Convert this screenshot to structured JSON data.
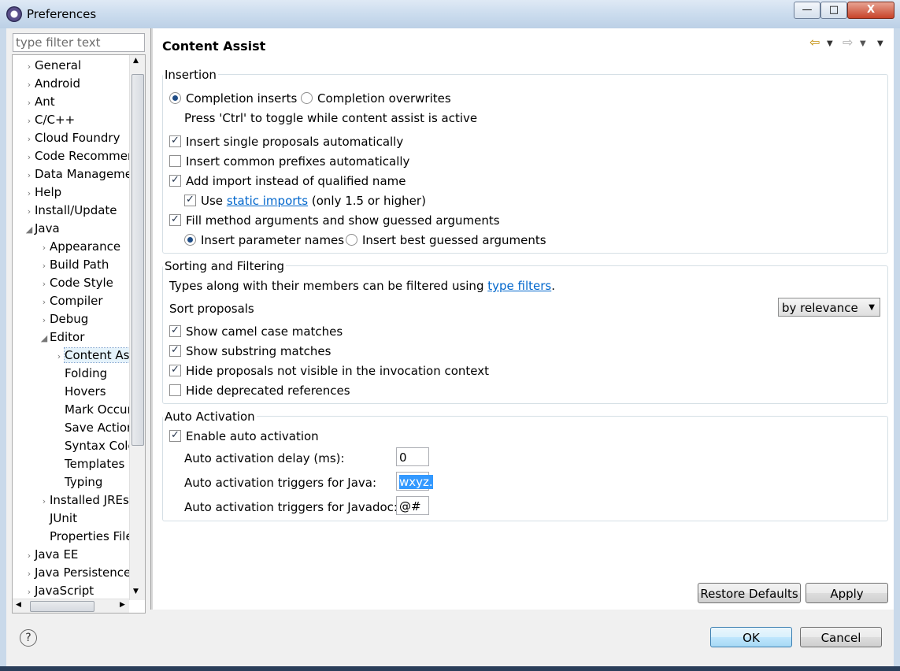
{
  "window": {
    "title": "Preferences",
    "buttons": {
      "minimize": "—",
      "maximize": "□",
      "close": "X"
    }
  },
  "filter": {
    "placeholder": "type filter text"
  },
  "tree": [
    {
      "label": "General",
      "level": 0,
      "twisty": "›"
    },
    {
      "label": "Android",
      "level": 0,
      "twisty": "›"
    },
    {
      "label": "Ant",
      "level": 0,
      "twisty": "›"
    },
    {
      "label": "C/C++",
      "level": 0,
      "twisty": "›"
    },
    {
      "label": "Cloud Foundry",
      "level": 0,
      "twisty": "›"
    },
    {
      "label": "Code Recommenders",
      "level": 0,
      "twisty": "›"
    },
    {
      "label": "Data Management",
      "level": 0,
      "twisty": "›"
    },
    {
      "label": "Help",
      "level": 0,
      "twisty": "›"
    },
    {
      "label": "Install/Update",
      "level": 0,
      "twisty": "›"
    },
    {
      "label": "Java",
      "level": 0,
      "twisty": "◢"
    },
    {
      "label": "Appearance",
      "level": 1,
      "twisty": "›"
    },
    {
      "label": "Build Path",
      "level": 1,
      "twisty": "›"
    },
    {
      "label": "Code Style",
      "level": 1,
      "twisty": "›"
    },
    {
      "label": "Compiler",
      "level": 1,
      "twisty": "›"
    },
    {
      "label": "Debug",
      "level": 1,
      "twisty": "›"
    },
    {
      "label": "Editor",
      "level": 1,
      "twisty": "◢"
    },
    {
      "label": "Content Assist",
      "level": 2,
      "twisty": "›",
      "selected": true
    },
    {
      "label": "Folding",
      "level": 2,
      "twisty": ""
    },
    {
      "label": "Hovers",
      "level": 2,
      "twisty": ""
    },
    {
      "label": "Mark Occurrences",
      "level": 2,
      "twisty": ""
    },
    {
      "label": "Save Actions",
      "level": 2,
      "twisty": ""
    },
    {
      "label": "Syntax Coloring",
      "level": 2,
      "twisty": ""
    },
    {
      "label": "Templates",
      "level": 2,
      "twisty": ""
    },
    {
      "label": "Typing",
      "level": 2,
      "twisty": ""
    },
    {
      "label": "Installed JREs",
      "level": 1,
      "twisty": "›"
    },
    {
      "label": "JUnit",
      "level": 1,
      "twisty": ""
    },
    {
      "label": "Properties Files Editor",
      "level": 1,
      "twisty": ""
    },
    {
      "label": "Java EE",
      "level": 0,
      "twisty": "›"
    },
    {
      "label": "Java Persistence",
      "level": 0,
      "twisty": "›"
    },
    {
      "label": "JavaScript",
      "level": 0,
      "twisty": "›"
    }
  ],
  "page": {
    "title": "Content Assist",
    "insertion": {
      "label": "Insertion",
      "radio_inserts": "Completion inserts",
      "radio_overwrites": "Completion overwrites",
      "hint": "Press 'Ctrl' to toggle while content assist is active",
      "single_proposals": "Insert single proposals automatically",
      "common_prefixes": "Insert common prefixes automatically",
      "add_import": "Add import instead of qualified name",
      "use_prefix": "Use",
      "static_imports": "static imports",
      "only_15": "(only 1.5 or higher)",
      "fill_args": "Fill method arguments and show guessed arguments",
      "param_names": "Insert parameter names",
      "best_guessed": "Insert best guessed arguments"
    },
    "sorting": {
      "label": "Sorting and Filtering",
      "filter_text": "Types along with their members can be filtered using",
      "type_filters": "type filters",
      "period": ".",
      "sort_label": "Sort proposals",
      "sort_value": "by relevance",
      "camel": "Show camel case matches",
      "substring": "Show substring matches",
      "hide_invisible": "Hide proposals not visible in the invocation context",
      "hide_deprecated": "Hide deprecated references"
    },
    "auto": {
      "label": "Auto Activation",
      "enable": "Enable auto activation",
      "delay_label": "Auto activation delay (ms):",
      "delay_value": "0",
      "java_label": "Auto activation triggers for Java:",
      "java_value": "wxyz.",
      "javadoc_label": "Auto activation triggers for Javadoc:",
      "javadoc_value": "@#"
    },
    "restore_defaults": "Restore Defaults",
    "apply": "Apply"
  },
  "footer": {
    "help": "?",
    "ok": "OK",
    "cancel": "Cancel"
  }
}
